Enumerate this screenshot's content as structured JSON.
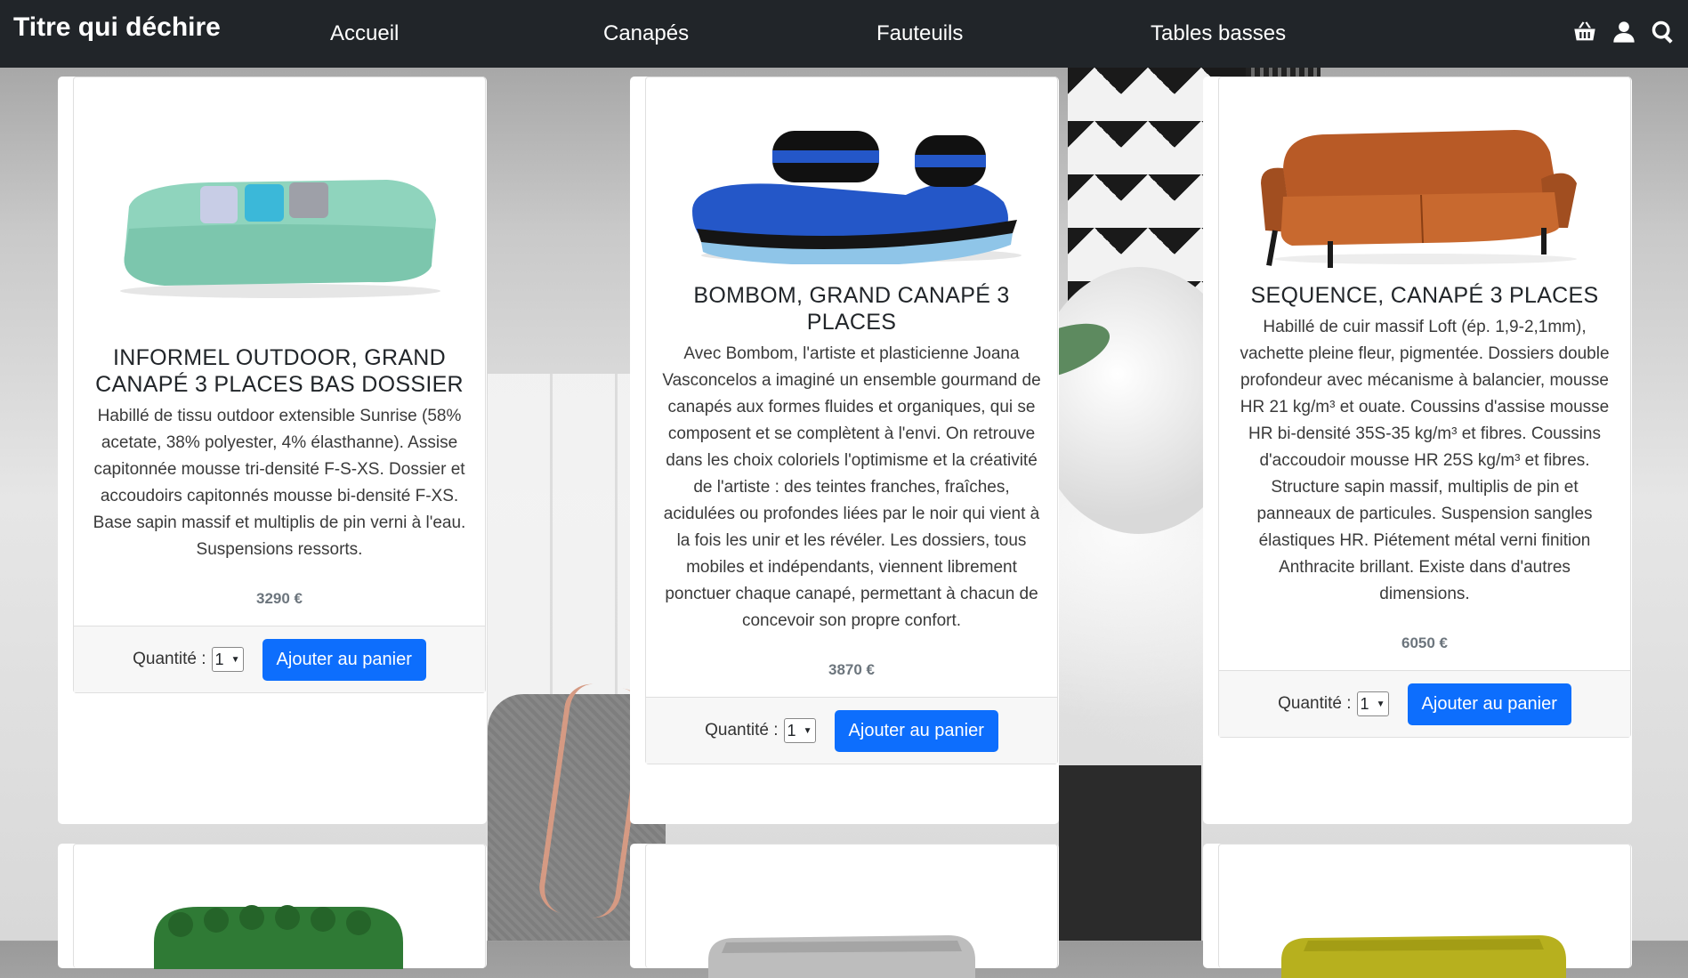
{
  "navbar": {
    "brand": "Titre qui déchire",
    "links": [
      "Accueil",
      "Canapés",
      "Fauteuils",
      "Tables basses"
    ],
    "icons": [
      "basket-icon",
      "user-icon",
      "search-icon"
    ]
  },
  "products": [
    {
      "title": "INFORMEL OUTDOOR, GRAND CANAPÉ 3 PLACES BAS DOSSIER",
      "description": "Habillé de tissu outdoor extensible Sunrise (58% acetate, 38% polyester, 4% élasthanne). Assise capitonnée mousse tri-densité F-S-XS. Dossier et accoudoirs capitonnés mousse bi-densité F-XS. Base sapin massif et multiplis de pin verni à l'eau. Suspensions ressorts.",
      "price": "3290 €",
      "quantity_label": "Quantité :",
      "quantity": "1",
      "button": "Ajouter au panier",
      "color": "#8fd4bd"
    },
    {
      "title": "BOMBOM, GRAND CANAPÉ 3 PLACES",
      "description": "Avec Bombom, l'artiste et plasticienne Joana Vasconcelos a imaginé un ensemble gourmand de canapés aux formes fluides et organiques, qui se composent et se complètent à l'envi. On retrouve dans les choix coloriels l'optimisme et la créativité de l'artiste : des teintes franches, fraîches, acidulées ou profondes liées par le noir qui vient à la fois les unir et les révéler. Les dossiers, tous mobiles et indépendants, viennent librement ponctuer chaque canapé, permettant à chacun de concevoir son propre confort.",
      "price": "3870 €",
      "quantity_label": "Quantité :",
      "quantity": "1",
      "button": "Ajouter au panier",
      "color": "#2457c8"
    },
    {
      "title": "SEQUENCE, CANAPÉ 3 PLACES",
      "description": "Habillé de cuir massif Loft (ép. 1,9-2,1mm), vachette pleine fleur, pigmentée. Dossiers double profondeur avec mécanisme à balancier, mousse HR 21 kg/m³ et ouate. Coussins d'assise mousse HR bi-densité 35S-35 kg/m³ et fibres. Coussins d'accoudoir mousse HR 25S kg/m³ et fibres. Structure sapin massif, multiplis de pin et panneaux de particules. Suspension sangles élastiques HR. Piétement métal verni finition Anthracite brillant. Existe dans d'autres dimensions.",
      "price": "6050 €",
      "quantity_label": "Quantité :",
      "quantity": "1",
      "button": "Ajouter au panier",
      "color": "#b85a26"
    }
  ],
  "colors": {
    "navbar_bg": "#212529",
    "button_bg": "#0d6efd",
    "price_text": "#6c757d"
  }
}
